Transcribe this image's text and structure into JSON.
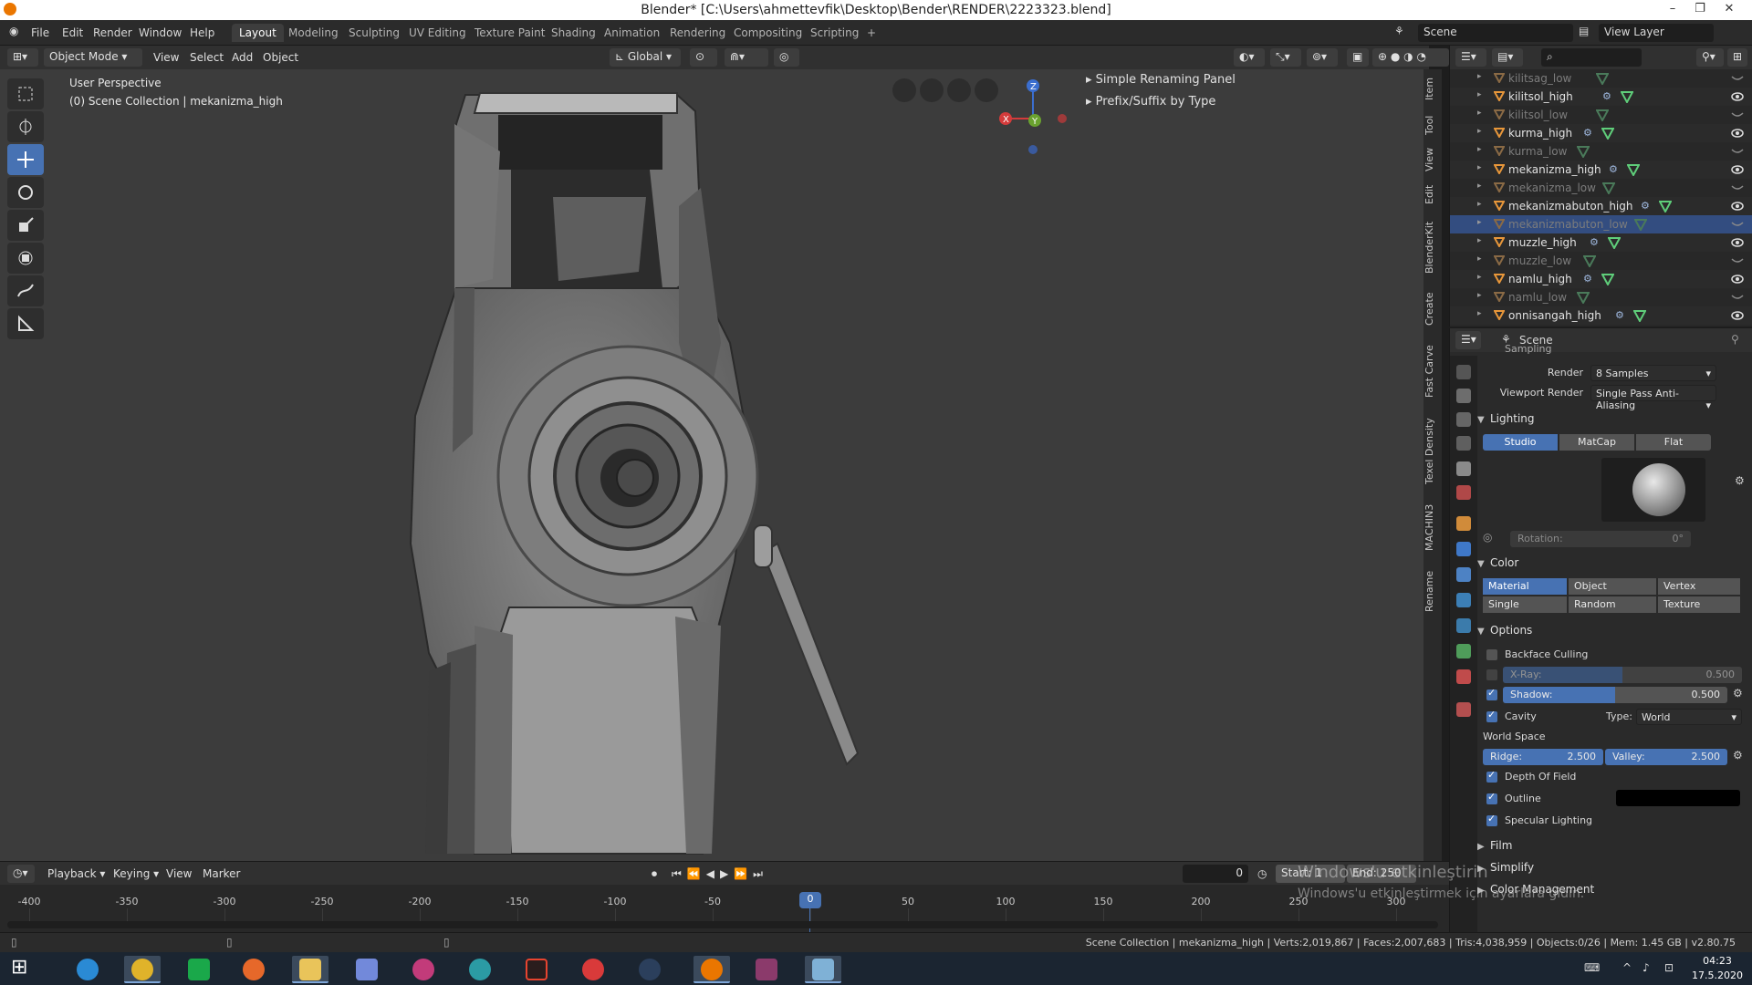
{
  "window": {
    "title": "Blender* [C:\\Users\\ahmettevfik\\Desktop\\Bender\\RENDER\\2223323.blend]"
  },
  "menu": {
    "items": [
      "File",
      "Edit",
      "Render",
      "Window",
      "Help"
    ]
  },
  "workspaces": {
    "tabs": [
      "Layout",
      "Modeling",
      "Sculpting",
      "UV Editing",
      "Texture Paint",
      "Shading",
      "Animation",
      "Rendering",
      "Compositing",
      "Scripting"
    ],
    "active": "Layout",
    "add": "+"
  },
  "scene": {
    "label": "Scene",
    "view_layer": "View Layer"
  },
  "viewport_header": {
    "mode": "Object Mode",
    "menus": [
      "View",
      "Select",
      "Add",
      "Object"
    ],
    "orientation": "Global"
  },
  "viewport": {
    "line1": "User Perspective",
    "line2": "(0) Scene Collection | mekanizma_high",
    "addon_panels": [
      "Simple Renaming Panel",
      "Prefix/Suffix by Type"
    ],
    "axes": {
      "x": "X",
      "y": "Y",
      "z": "Z"
    }
  },
  "side_tabs": [
    "Item",
    "Tool",
    "View",
    "Edit",
    "BlenderKit",
    "Create",
    "Fast Carve",
    "Texel Density",
    "MACHIN3",
    "Rename"
  ],
  "outliner": {
    "rows": [
      {
        "name": "kilitsag_low",
        "dim": true
      },
      {
        "name": "kilitsol_high",
        "dim": false
      },
      {
        "name": "kilitsol_low",
        "dim": true
      },
      {
        "name": "kurma_high",
        "dim": false
      },
      {
        "name": "kurma_low",
        "dim": true
      },
      {
        "name": "mekanizma_high",
        "dim": false
      },
      {
        "name": "mekanizma_low",
        "dim": true
      },
      {
        "name": "mekanizmabuton_high",
        "dim": false
      },
      {
        "name": "mekanizmabuton_low",
        "dim": true,
        "selected": true
      },
      {
        "name": "muzzle_high",
        "dim": false
      },
      {
        "name": "muzzle_low",
        "dim": true
      },
      {
        "name": "namlu_high",
        "dim": false
      },
      {
        "name": "namlu_low",
        "dim": true
      },
      {
        "name": "onnisangah_high",
        "dim": false
      }
    ]
  },
  "properties": {
    "header": "Scene",
    "sampling": {
      "title": "Sampling",
      "render_label": "Render",
      "render_value": "8 Samples",
      "viewport_label": "Viewport Render",
      "viewport_value": "Single Pass Anti-Aliasing"
    },
    "lighting": {
      "title": "Lighting",
      "modes": [
        "Studio",
        "MatCap",
        "Flat"
      ],
      "active": "Studio",
      "rotation_label": "Rotation:",
      "rotation_value": "0°"
    },
    "color": {
      "title": "Color",
      "row1": [
        "Material",
        "Object",
        "Vertex"
      ],
      "row2": [
        "Single",
        "Random",
        "Texture"
      ],
      "active": "Material"
    },
    "options": {
      "title": "Options",
      "backface": "Backface Culling",
      "xray_label": "X-Ray:",
      "xray_value": "0.500",
      "xray_fraction": 0.5,
      "shadow_label": "Shadow:",
      "shadow_value": "0.500",
      "shadow_fraction": 0.5,
      "cavity": "Cavity",
      "type_label": "Type:",
      "type_value": "World",
      "world_space": "World Space",
      "ridge_label": "Ridge:",
      "ridge_value": "2.500",
      "valley_label": "Valley:",
      "valley_value": "2.500",
      "dof": "Depth Of Field",
      "outline": "Outline",
      "specular": "Specular Lighting"
    },
    "collapsed": [
      "Film",
      "Simplify",
      "Color Management"
    ]
  },
  "timeline": {
    "menus": [
      "Playback",
      "Keying",
      "View",
      "Marker"
    ],
    "current_frame": "0",
    "start_label": "Start:",
    "start_value": "1",
    "end_label": "End:",
    "end_value": "250",
    "ticks": [
      "-400",
      "-350",
      "-300",
      "-250",
      "-200",
      "-150",
      "-100",
      "-50",
      "0",
      "50",
      "100",
      "150",
      "200",
      "250",
      "300"
    ],
    "frame_badge": "0"
  },
  "status": {
    "text": "Scene Collection | mekanizma_high | Verts:2,019,867 | Faces:2,007,683 | Tris:4,038,959 | Objects:0/26 | Mem: 1.45 GB | v2.80.75"
  },
  "watermark": {
    "line1": "Windows'u etkinleştirin",
    "line2": "Windows'u etkinleştirmek için ayarlara gidin."
  },
  "taskbar": {
    "time": "04:23",
    "date": "17.5.2020"
  },
  "colors": {
    "accent": "#4772b3",
    "selection": "#334d80",
    "viewport_bg": "#3c3c3c"
  }
}
